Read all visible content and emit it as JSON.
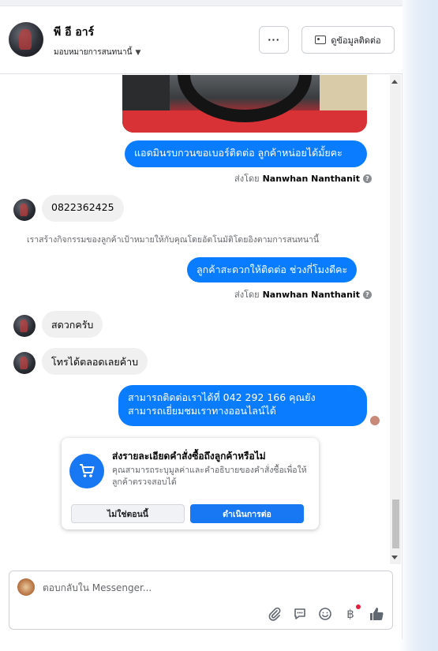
{
  "header": {
    "contact_name": "พี อี อาร์",
    "assign_label": "มอบหมายการสนทนานี้",
    "more_label": "···",
    "contact_info_label": "ดูข้อมูลติดต่อ"
  },
  "messages": {
    "ask_phone": "แอดมินรบกวนขอเบอร์ติดต่อ ลูกค้าหน่อยได้มั้ยคะ",
    "sent_by_prefix": "ส่งโดย",
    "sender_name": "Nanwhan Nanthanit",
    "phone_reply": "0822362425",
    "system_note": "เราสร้างกิจกรรมของลูกค้าเป้าหมายให้กับคุณโดยอัตโนมัติโดยอิงตามการสนทนานี้",
    "ask_time": "ลูกค้าสะดวกให้ติดต่อ ช่วงกี่โมงดีคะ",
    "reply_convenient": "สดวกครับ",
    "reply_anytime": "โทรได้ตลอดเลยค้าบ",
    "contact_line1": "สามารถติดต่อเราได้ที่ 042 292 166 คุณยัง",
    "contact_line2": "สามารถเยี่ยมชมเราทางออนไลน์ได้"
  },
  "order_card": {
    "title": "ส่งรายละเอียดคำสั่งซื้อถึงลูกค้าหรือไม่",
    "description": "คุณสามารถระบุมูลค่าและคำอธิบายของคำสั่งซื้อเพื่อให้ลูกค้าตรวจสอบได้",
    "not_now_label": "ไม่ใช่ตอนนี้",
    "continue_label": "ดำเนินการต่อ"
  },
  "composer": {
    "placeholder": "ตอบกลับใน Messenger..."
  },
  "icons": [
    "more-icon",
    "contact-card-icon",
    "cart-icon",
    "attachment-icon",
    "saved-replies-icon",
    "emoji-icon",
    "baht-icon",
    "like-icon"
  ],
  "colors": {
    "accent": "#0a7cff",
    "brand": "#1877f2",
    "incoming_bubble": "#f0f0f0",
    "notification_dot": "#e41e3f"
  }
}
